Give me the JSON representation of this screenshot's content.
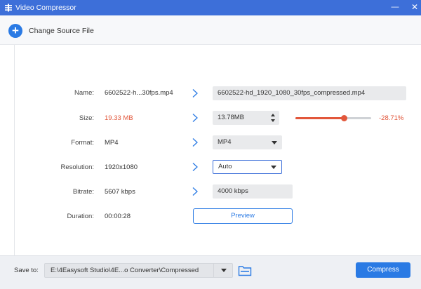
{
  "window": {
    "title": "Video Compressor",
    "minimize_glyph": "—",
    "close_glyph": "✕"
  },
  "source": {
    "change_label": "Change Source File"
  },
  "rows": {
    "name": {
      "label": "Name:",
      "original": "6602522-h...30fps.mp4",
      "output": "6602522-hd_1920_1080_30fps_compressed.mp4"
    },
    "size": {
      "label": "Size:",
      "original": "19.33 MB",
      "output": "13.78MB",
      "slider_fraction": 0.64,
      "percent_change": "-28.71%"
    },
    "format": {
      "label": "Format:",
      "original": "MP4",
      "output": "MP4"
    },
    "resolution": {
      "label": "Resolution:",
      "original": "1920x1080",
      "output": "Auto"
    },
    "bitrate": {
      "label": "Bitrate:",
      "original": "5607 kbps",
      "output": "4000 kbps"
    },
    "duration": {
      "label": "Duration:",
      "original": "00:00:28"
    }
  },
  "preview_label": "Preview",
  "bottom": {
    "save_label": "Save to:",
    "save_path": "E:\\4Easysoft Studio\\4E...o Converter\\Compressed",
    "compress_label": "Compress"
  },
  "icons": {
    "app": "app-logo-icon",
    "plus": "plus-icon",
    "chevron": "chevron-right-icon",
    "folder": "folder-icon"
  },
  "colors": {
    "titlebar": "#3d6fd9",
    "accent": "#2a7ae4",
    "reduction": "#e2573b"
  }
}
